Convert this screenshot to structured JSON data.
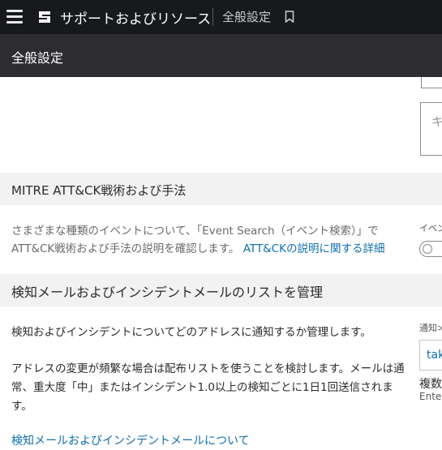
{
  "topbar": {
    "app_title": "サポートおよびリソース",
    "breadcrumb": "全般設定"
  },
  "subheader": {
    "title": "全般設定"
  },
  "textarea_stub": {
    "placeholder_fragment": "キ"
  },
  "mitre": {
    "title": "MITRE ATT&CK戦術および手法",
    "desc_line1": "さまざまな種類のイベントについて、「Event Search（イベント検索）」で",
    "desc_line2": "ATT&CK戦術および手法の説明を確認します。",
    "link": "ATT&CKの説明に関する詳細",
    "toggle_label_fragment": "イベン"
  },
  "detection_email": {
    "title": "検知メールおよびインシデントメールのリストを管理",
    "desc1": "検知およびインシデントについてどのアドレスに通知するか管理します。",
    "desc2": "アドレスの変更が頻繁な場合は配布リストを使うことを検討します。メールは通常、重大度「中」またはインシデント1.0以上の検知ごとに1日1回送信されます。",
    "link": "検知メールおよびインシデントメールについて",
    "field_label_fragment": "通知>",
    "field_value_fragment": "tak",
    "multi_label_fragment": "複数",
    "enter_hint_fragment": "Ente"
  }
}
